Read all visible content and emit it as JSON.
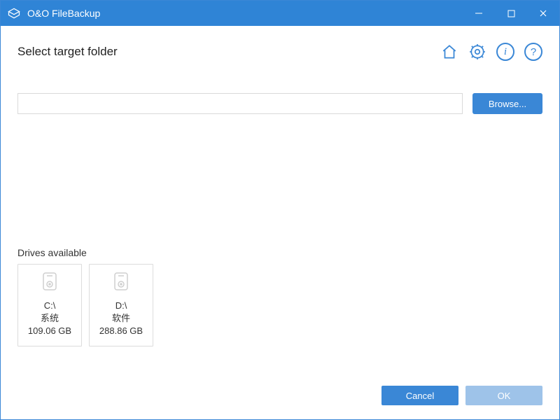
{
  "titlebar": {
    "title": "O&O FileBackup"
  },
  "page": {
    "heading": "Select target folder",
    "browse_label": "Browse...",
    "path_value": "",
    "drives_label": "Drives available"
  },
  "drives": [
    {
      "letter": "C:\\",
      "name": "系统",
      "size": "109.06 GB"
    },
    {
      "letter": "D:\\",
      "name": "软件",
      "size": "288.86 GB"
    }
  ],
  "footer": {
    "cancel": "Cancel",
    "ok": "OK"
  }
}
